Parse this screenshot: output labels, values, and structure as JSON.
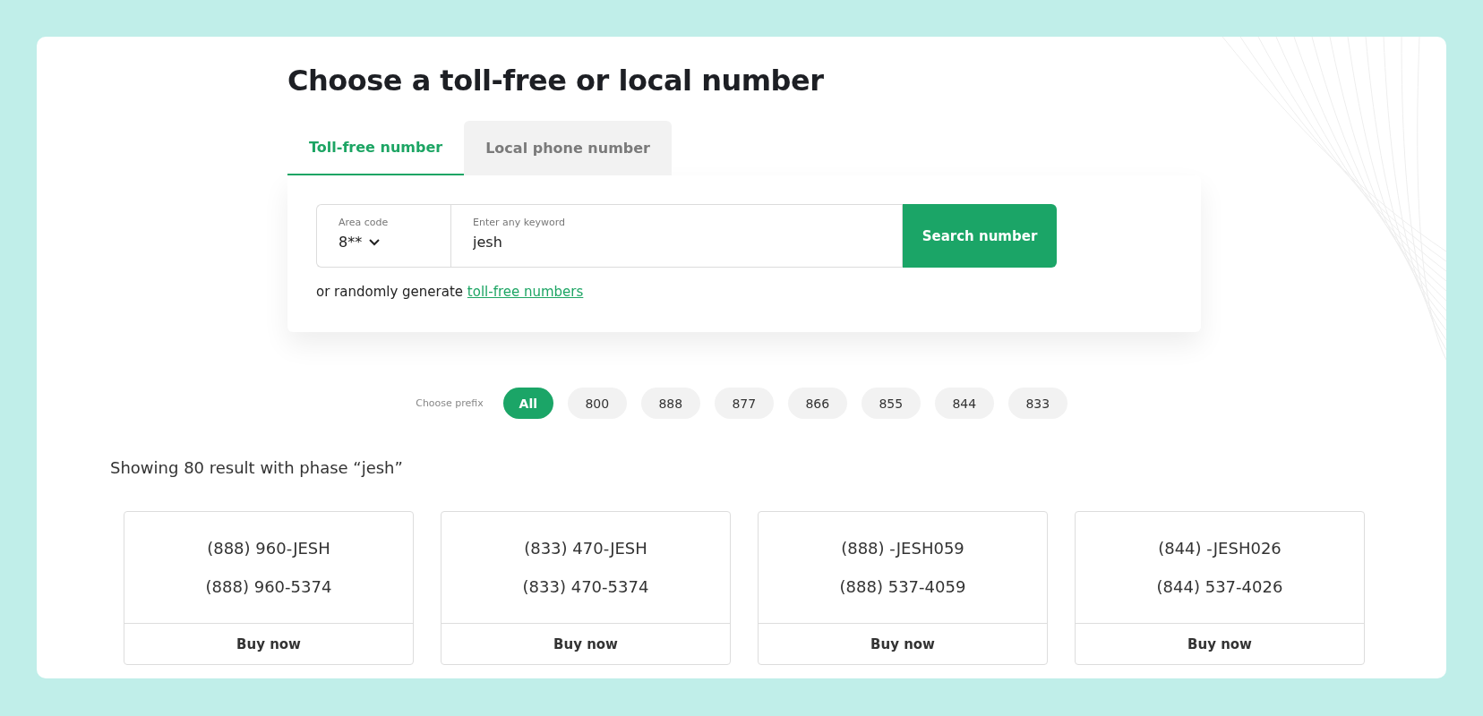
{
  "title": "Choose a toll-free or local number",
  "tabs": [
    {
      "label": "Toll-free number",
      "selected": true
    },
    {
      "label": "Local phone number",
      "selected": false
    }
  ],
  "search": {
    "area_code": {
      "label": "Area code",
      "value": "8**"
    },
    "keyword": {
      "label": "Enter any keyword",
      "value": "jesh"
    },
    "button": "Search number"
  },
  "random": {
    "text": "or randomly generate ",
    "link": "toll-free numbers"
  },
  "prefix": {
    "label": "Choose prefix",
    "options": [
      {
        "label": "All",
        "selected": true
      },
      {
        "label": "800",
        "selected": false
      },
      {
        "label": "888",
        "selected": false
      },
      {
        "label": "877",
        "selected": false
      },
      {
        "label": "866",
        "selected": false
      },
      {
        "label": "855",
        "selected": false
      },
      {
        "label": "844",
        "selected": false
      },
      {
        "label": "833",
        "selected": false
      }
    ]
  },
  "results_summary": "Showing 80 result with phase “jesh”",
  "results": [
    {
      "vanity": "(888) 960-JESH",
      "number": "(888) 960-5374",
      "button": "Buy now"
    },
    {
      "vanity": "(833) 470-JESH",
      "number": "(833) 470-5374",
      "button": "Buy now"
    },
    {
      "vanity": "(888) -JESH059",
      "number": "(888) 537-4059",
      "button": "Buy now"
    },
    {
      "vanity": "(844) -JESH026",
      "number": "(844) 537-4026",
      "button": "Buy now"
    }
  ]
}
